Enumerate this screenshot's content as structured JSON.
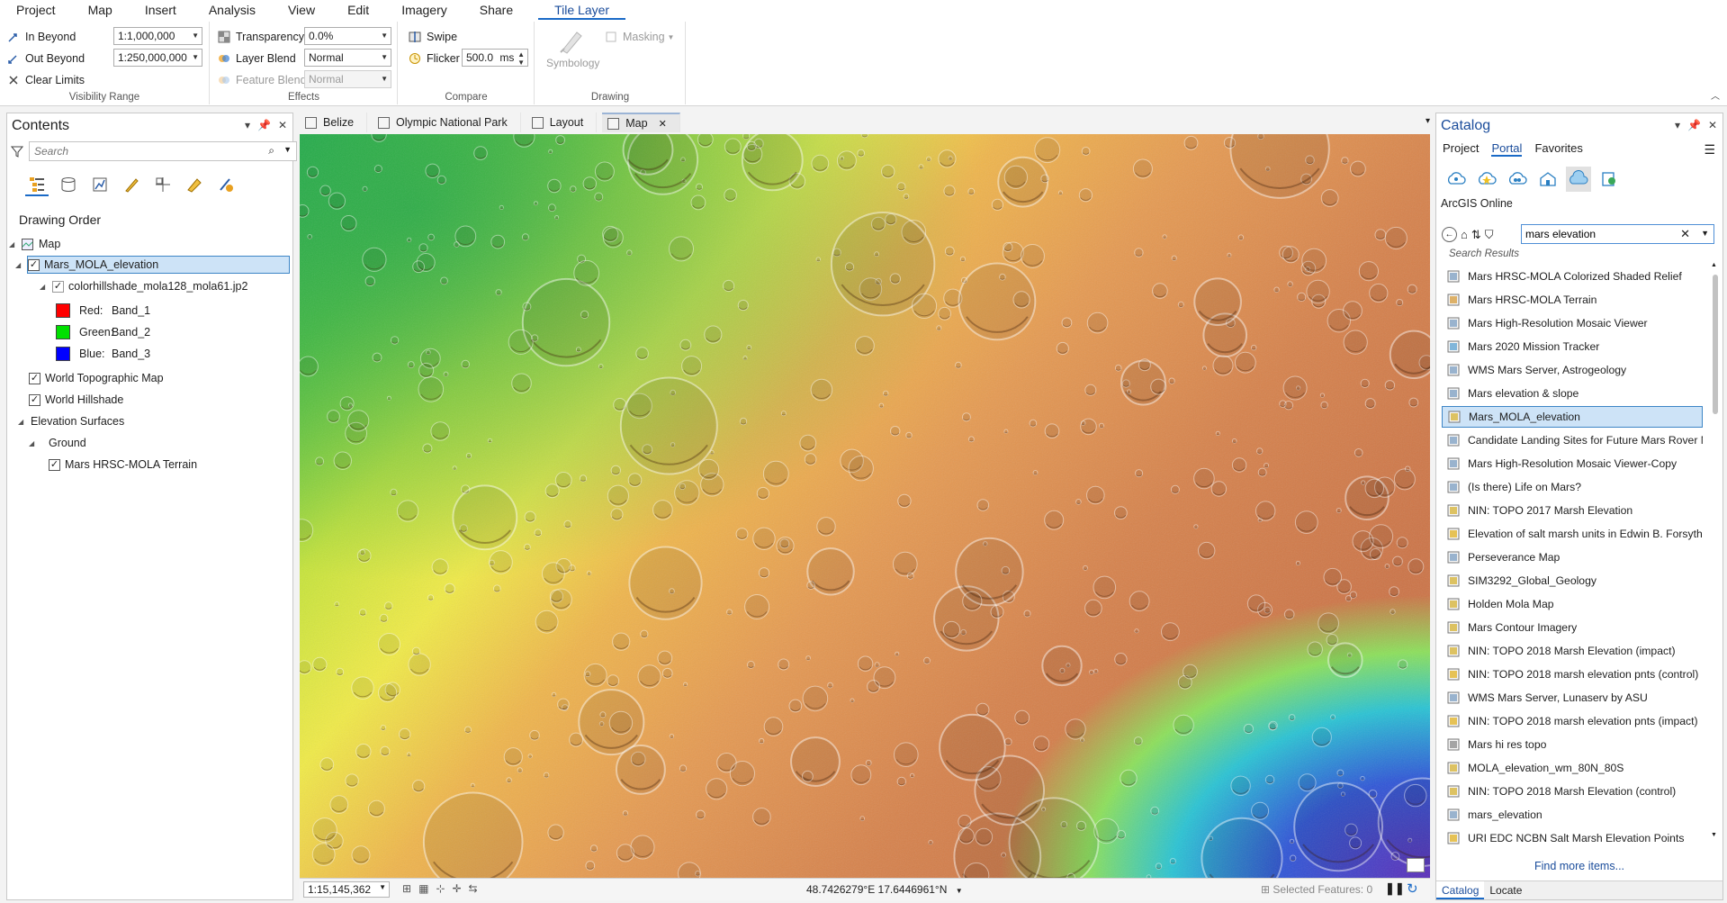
{
  "ribbon": {
    "tabs": [
      "Project",
      "Map",
      "Insert",
      "Analysis",
      "View",
      "Edit",
      "Imagery",
      "Share",
      "Tile Layer"
    ],
    "visibility_range": {
      "in_beyond_label": "In Beyond",
      "in_beyond_value": "1:1,000,000",
      "out_beyond_label": "Out Beyond",
      "out_beyond_value": "1:250,000,000",
      "clear_limits_label": "Clear Limits",
      "group_label": "Visibility Range"
    },
    "effects": {
      "transparency_label": "Transparency",
      "transparency_value": "0.0%",
      "layer_blend_label": "Layer Blend",
      "layer_blend_value": "Normal",
      "feature_blend_label": "Feature Blend",
      "feature_blend_value": "Normal",
      "group_label": "Effects"
    },
    "compare": {
      "swipe_label": "Swipe",
      "flicker_label": "Flicker",
      "flicker_value": "500.0",
      "flicker_unit": "ms",
      "group_label": "Compare"
    },
    "drawing": {
      "symbology_label": "Symbology",
      "masking_label": "Masking",
      "group_label": "Drawing"
    }
  },
  "contents": {
    "title": "Contents",
    "search_placeholder": "Search",
    "drawing_order_label": "Drawing Order",
    "map_label": "Map",
    "layer_selected": "Mars_MOLA_elevation",
    "sublayer": "colorhillshade_mola128_mola61.jp2",
    "bands": [
      {
        "channel": "Red:",
        "band": "Band_1",
        "color": "#ff0000"
      },
      {
        "channel": "Green:",
        "band": "Band_2",
        "color": "#00e000"
      },
      {
        "channel": "Blue:",
        "band": "Band_3",
        "color": "#0000ff"
      }
    ],
    "world_topo": "World Topographic Map",
    "world_hillshade": "World Hillshade",
    "elevation_surfaces": "Elevation Surfaces",
    "ground": "Ground",
    "terrain": "Mars HRSC-MOLA Terrain"
  },
  "view_tabs": [
    "Belize",
    "Olympic National Park",
    "Layout",
    "Map"
  ],
  "map_status": {
    "scale": "1:15,145,362",
    "coordinates": "48.7426279°E 17.6446961°N",
    "selected_features": "Selected Features: 0"
  },
  "catalog": {
    "title": "Catalog",
    "tabs": [
      "Project",
      "Portal",
      "Favorites"
    ],
    "source_label": "ArcGIS Online",
    "search_value": "mars elevation",
    "results_header": "Search Results",
    "results": [
      "Mars HRSC-MOLA Colorized Shaded Relief",
      "Mars HRSC-MOLA Terrain",
      "Mars High-Resolution Mosaic Viewer",
      "Mars 2020 Mission Tracker",
      "WMS Mars Server, Astrogeology",
      "Mars elevation & slope",
      "Mars_MOLA_elevation",
      "Candidate Landing Sites for Future Mars Rover M",
      "Mars High-Resolution Mosaic Viewer-Copy",
      "(Is there) Life on Mars?",
      "NIN: TOPO 2017 Marsh Elevation",
      "Elevation of salt marsh units in Edwin B. Forsythe",
      "Perseverance Map",
      "SIM3292_Global_Geology",
      "Holden Mola Map",
      "Mars Contour Imagery",
      "NIN: TOPO 2018 Marsh Elevation (impact)",
      "NIN: TOPO 2018 marsh elevation pnts (control)",
      "WMS Mars Server, Lunaserv by ASU",
      "NIN: TOPO 2018 marsh elevation pnts (impact)",
      "Mars hi res topo",
      "MOLA_elevation_wm_80N_80S",
      "NIN: TOPO 2018 Marsh Elevation (control)",
      "mars_elevation",
      "URI EDC NCBN Salt Marsh Elevation Points"
    ],
    "find_more": "Find more items...",
    "bottom_tabs": [
      "Catalog",
      "Locate"
    ]
  }
}
